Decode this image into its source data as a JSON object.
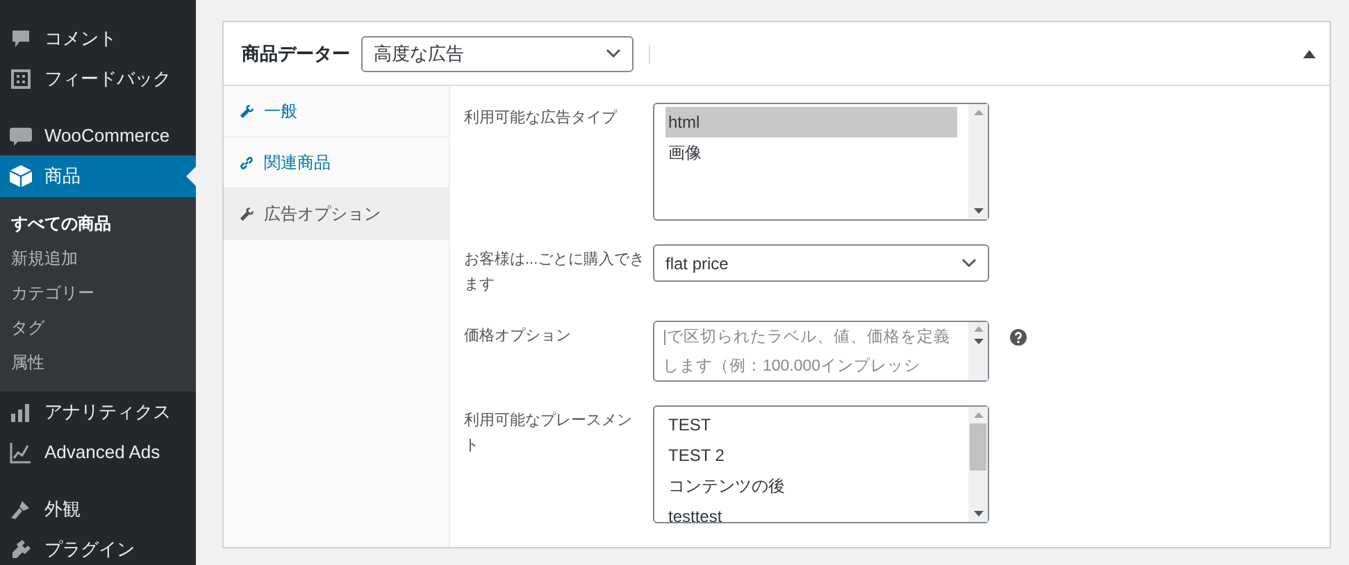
{
  "sidebar": {
    "items": [
      {
        "label": "コメント",
        "selected": false,
        "separator_before": false
      },
      {
        "label": "フィードバック",
        "selected": false,
        "separator_before": false
      },
      {
        "label": "WooCommerce",
        "selected": false,
        "separator_before": true
      },
      {
        "label": "商品",
        "selected": true,
        "separator_before": false,
        "submenu": [
          {
            "label": "すべての商品",
            "selected": true
          },
          {
            "label": "新規追加",
            "selected": false
          },
          {
            "label": "カテゴリー",
            "selected": false
          },
          {
            "label": "タグ",
            "selected": false
          },
          {
            "label": "属性",
            "selected": false
          }
        ]
      },
      {
        "label": "アナリティクス",
        "selected": false,
        "separator_before": false
      },
      {
        "label": "Advanced Ads",
        "selected": false,
        "separator_before": false
      },
      {
        "label": "外観",
        "selected": false,
        "separator_before": true
      },
      {
        "label": "プラグイン",
        "selected": false,
        "separator_before": false
      }
    ]
  },
  "panel": {
    "title": "商品データー",
    "type_select": {
      "value": "高度な広告"
    },
    "tabs": [
      {
        "label": "一般",
        "selected": false
      },
      {
        "label": "関連商品",
        "selected": false
      },
      {
        "label": "広告オプション",
        "selected": true
      }
    ],
    "fields": [
      {
        "kind": "listbox",
        "label": "利用可能な広告タイプ",
        "options": [
          {
            "label": "html",
            "selected": true
          },
          {
            "label": "画像",
            "selected": false
          }
        ],
        "scroll_thumb": false
      },
      {
        "kind": "select",
        "label": "お客様は...ごとに購入できます",
        "value": "flat price"
      },
      {
        "kind": "textarea",
        "label": "価格オプション",
        "placeholder": "|で区切られたラベル、値、価格を定義します（例：100.000インプレッシ",
        "help": true
      },
      {
        "kind": "listbox",
        "label": "利用可能なプレースメント",
        "options": [
          {
            "label": "TEST",
            "selected": false
          },
          {
            "label": "TEST 2",
            "selected": false
          },
          {
            "label": "コンテンツの後",
            "selected": false
          },
          {
            "label": "testtest",
            "selected": false
          }
        ],
        "scroll_thumb": true
      }
    ]
  }
}
